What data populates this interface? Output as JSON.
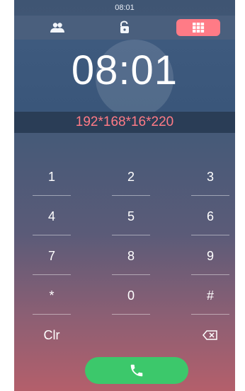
{
  "status": {
    "time": "08:01"
  },
  "nav": {
    "items": [
      {
        "name": "contacts",
        "icon": "contacts-icon",
        "active": false
      },
      {
        "name": "unlock",
        "icon": "unlock-icon",
        "active": false
      },
      {
        "name": "dialpad",
        "icon": "dialpad-icon",
        "active": true
      }
    ]
  },
  "clock": {
    "time": "08:01"
  },
  "dial": {
    "input": "192*168*16*220"
  },
  "keypad": {
    "keys": [
      "1",
      "2",
      "3",
      "4",
      "5",
      "6",
      "7",
      "8",
      "9",
      "*",
      "0",
      "#"
    ],
    "clear_label": "Clr",
    "backspace_icon": "backspace-icon"
  },
  "call": {
    "icon": "phone-icon"
  },
  "colors": {
    "accent": "#ff7b86",
    "call_green": "#3cc86b",
    "nav_bg": "#4a5f7d",
    "ip_bar_bg": "#2a3d56"
  }
}
